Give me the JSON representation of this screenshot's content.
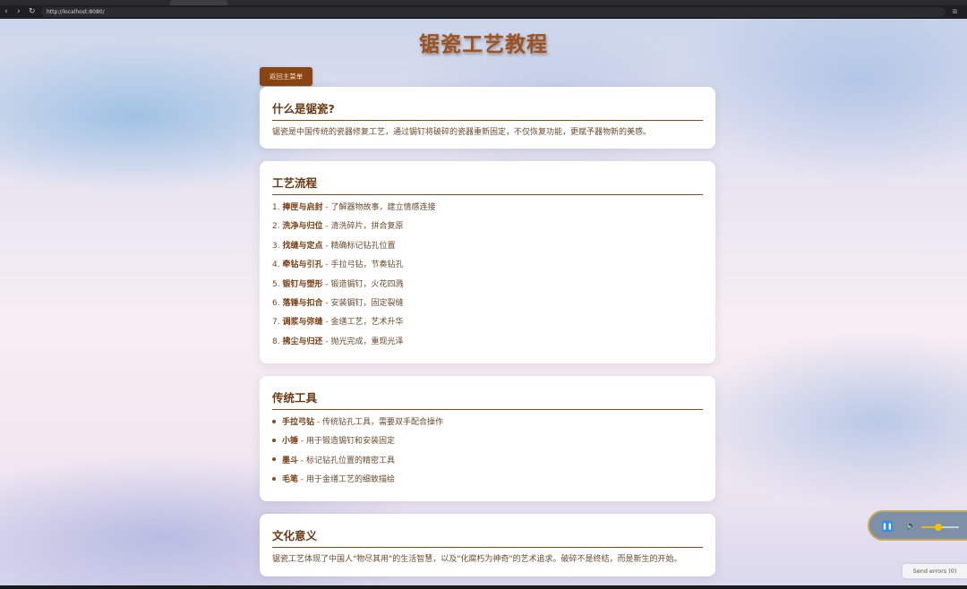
{
  "browser": {
    "nav": {
      "back": "‹",
      "forward": "›",
      "reload": "↻"
    },
    "url": "http://localhost:8080/",
    "extension_icon": "puzzle-icon"
  },
  "page": {
    "title": "锯瓷工艺教程",
    "back_button": "返回主菜单"
  },
  "sections": {
    "what": {
      "heading": "什么是锯瓷?",
      "text": "锯瓷是中国传统的瓷器修复工艺，通过锔钉将破碎的瓷器重新固定，不仅恢复功能，更赋予器物新的美感。"
    },
    "process": {
      "heading": "工艺流程",
      "steps": [
        {
          "num": "1.",
          "name": "捧匣与启封",
          "desc": " - 了解器物故事，建立情感连接"
        },
        {
          "num": "2.",
          "name": "洗净与归位",
          "desc": " - 清洗碎片，拼合复原"
        },
        {
          "num": "3.",
          "name": "找缝与定点",
          "desc": " - 精确标记钻孔位置"
        },
        {
          "num": "4.",
          "name": "牵钻与引孔",
          "desc": " - 手拉弓钻，节奏钻孔"
        },
        {
          "num": "5.",
          "name": "锻钉与塑形",
          "desc": " - 锻造锔钉，火花四溅"
        },
        {
          "num": "6.",
          "name": "落锤与扣合",
          "desc": " - 安装锔钉，固定裂缝"
        },
        {
          "num": "7.",
          "name": "调浆与弥缝",
          "desc": " - 金缮工艺，艺术升华"
        },
        {
          "num": "8.",
          "name": "拂尘与归还",
          "desc": " - 抛光完成，重现光泽"
        }
      ]
    },
    "tools": {
      "heading": "传统工具",
      "items": [
        {
          "name": "手拉弓钻",
          "desc": " - 传统钻孔工具，需要双手配合操作"
        },
        {
          "name": "小锤",
          "desc": " - 用于锻造锔钉和安装固定"
        },
        {
          "name": "墨斗",
          "desc": " - 标记钻孔位置的精密工具"
        },
        {
          "name": "毛笔",
          "desc": " - 用于金缮工艺的细致描绘"
        }
      ]
    },
    "culture": {
      "heading": "文化意义",
      "text": "锯瓷工艺体现了中国人\"物尽其用\"的生活智慧，以及\"化腐朽为神奇\"的艺术追求。破碎不是终结，而是新生的开始。"
    }
  },
  "media_player": {
    "pause_icon": "pause-icon",
    "volume_icon": "volume-icon",
    "volume_level": 0.45
  },
  "errors_button": "Send errors (0)"
}
